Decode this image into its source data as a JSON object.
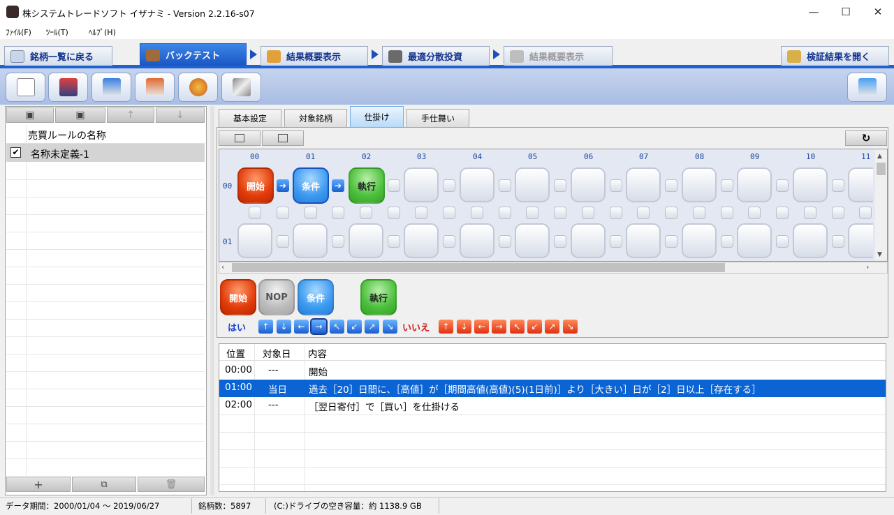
{
  "window": {
    "title": "株システムトレードソフト イザナミ - Version 2.2.16-s07",
    "minimize": "—",
    "maximize": "☐",
    "close": "✕"
  },
  "menu": [
    "ﾌｧｲﾙ(F)",
    "ﾂｰﾙ(T)",
    "ﾍﾙﾌﾟ(H)"
  ],
  "main_tabs": {
    "back": "銘柄一覧に戻る",
    "backtest": "バックテスト",
    "summary": "結果概要表示",
    "optimal": "最適分散投資",
    "summary2": "結果概要表示",
    "verify": "検証結果を開く"
  },
  "rule_list": {
    "header": "売買ルールの名称",
    "rows": [
      {
        "checked": "✔",
        "name": "名称未定義-1"
      }
    ],
    "add": "+",
    "copy": "⧉",
    "delete": "🗑"
  },
  "sub_tabs": [
    "基本設定",
    "対象銘柄",
    "仕掛け",
    "手仕舞い"
  ],
  "grid": {
    "cols": [
      "00",
      "01",
      "02",
      "03",
      "04",
      "05",
      "06",
      "07",
      "08",
      "09",
      "10",
      "11"
    ],
    "rows": [
      "00",
      "01"
    ],
    "nodes": {
      "start": "開始",
      "cond": "条件",
      "exec": "執行"
    }
  },
  "palette": {
    "start": "開始",
    "nop": "NOP",
    "cond": "条件",
    "exec": "執行",
    "yes": "はい",
    "no": "いいえ"
  },
  "list": {
    "headers": [
      "位置",
      "対象日",
      "内容"
    ],
    "rows": [
      {
        "pos": "00:00",
        "day": "---",
        "content": "開始"
      },
      {
        "pos": "01:00",
        "day": "当日",
        "content": "過去［20］日間に、［高値］が［期間高値(高値)(5)(1日前)］より［大きい］日が［2］日以上［存在する］"
      },
      {
        "pos": "02:00",
        "day": "---",
        "content": "［翌日寄付］で［買い］を仕掛ける"
      }
    ]
  },
  "status": {
    "period": "データ期間：2000/01/04 〜 2019/06/27",
    "count": "銘柄数：5897",
    "disk": "(C:)ドライブの空き容量：約 1138.9 GB"
  },
  "colors": {
    "accent": "#1e62d0",
    "selected_row": "#0a64d4",
    "yes": "#1a44cc",
    "no": "#cc1a1a"
  },
  "icons": [
    "eye-icon",
    "bag-icon",
    "chart-icon",
    "grid-icon",
    "stamp-icon",
    "new-doc-icon",
    "import-icon",
    "export-icon",
    "export2-icon",
    "palette-icon",
    "tools-icon",
    "save-icon",
    "up-icon",
    "down-icon",
    "refresh-icon"
  ]
}
